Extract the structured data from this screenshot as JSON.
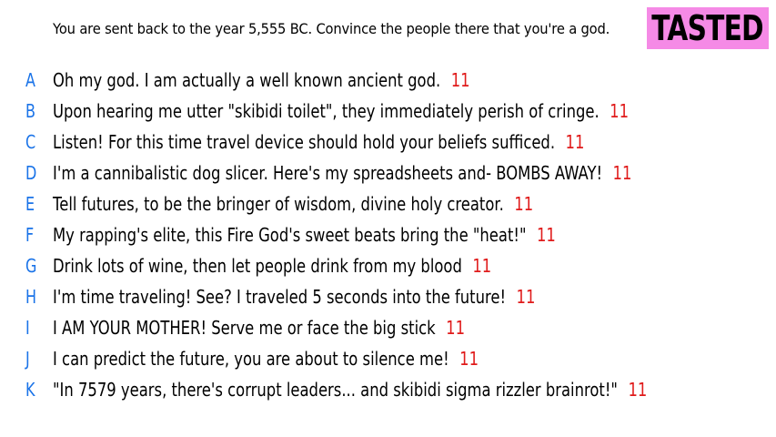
{
  "prompt": "You are sent back to the year 5,555 BC. Convince the people there that you're a god.",
  "badge": {
    "label": "TASTED",
    "color": "#f58ae6"
  },
  "colors": {
    "letter": "#1a73e8",
    "score": "#e01b1b",
    "text": "#000000"
  },
  "answers": [
    {
      "letter": "A",
      "text": "Oh my god. I am actually a well known ancient god.",
      "score": "11"
    },
    {
      "letter": "B",
      "text": "Upon hearing me utter \"skibidi toilet\", they immediately perish of cringe.",
      "score": "11"
    },
    {
      "letter": "C",
      "text": "Listen! For this time travel device should hold your beliefs sufficed.",
      "score": "11"
    },
    {
      "letter": "D",
      "text": "I'm a cannibalistic dog slicer. Here's my spreadsheets and- BOMBS AWAY!",
      "score": "11"
    },
    {
      "letter": "E",
      "text": "Tell futures, to be the bringer of wisdom, divine holy creator.",
      "score": "11"
    },
    {
      "letter": "F",
      "text": "My rapping's elite, this Fire God's sweet beats bring the \"heat!\"",
      "score": "11"
    },
    {
      "letter": "G",
      "text": "Drink lots of wine, then let people drink from my blood",
      "score": "11"
    },
    {
      "letter": "H",
      "text": "I'm time traveling! See? I traveled 5 seconds into the future!",
      "score": "11"
    },
    {
      "letter": "I",
      "text": "I AM YOUR MOTHER! Serve me or face the big stick",
      "score": "11"
    },
    {
      "letter": "J",
      "text": "I can predict the future, you are about to silence me!",
      "score": "11"
    },
    {
      "letter": "K",
      "text": "\"In 7579 years, there's corrupt leaders... and skibidi sigma rizzler brainrot!\"",
      "score": "11"
    }
  ]
}
